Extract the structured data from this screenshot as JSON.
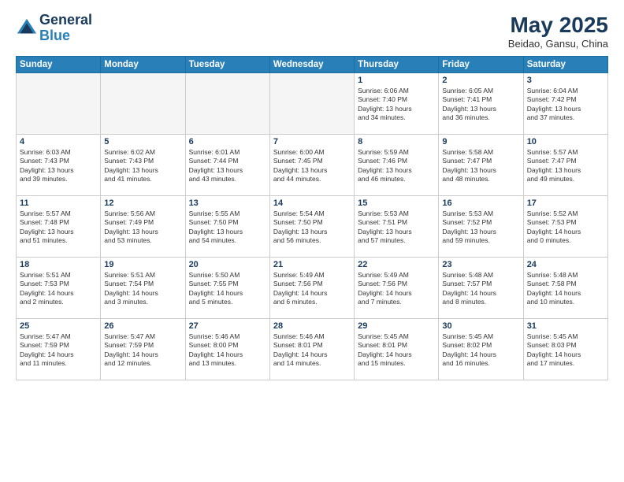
{
  "header": {
    "logo_line1": "General",
    "logo_line2": "Blue",
    "month_year": "May 2025",
    "location": "Beidao, Gansu, China"
  },
  "days_of_week": [
    "Sunday",
    "Monday",
    "Tuesday",
    "Wednesday",
    "Thursday",
    "Friday",
    "Saturday"
  ],
  "weeks": [
    [
      {
        "day": "",
        "info": ""
      },
      {
        "day": "",
        "info": ""
      },
      {
        "day": "",
        "info": ""
      },
      {
        "day": "",
        "info": ""
      },
      {
        "day": "1",
        "info": "Sunrise: 6:06 AM\nSunset: 7:40 PM\nDaylight: 13 hours\nand 34 minutes."
      },
      {
        "day": "2",
        "info": "Sunrise: 6:05 AM\nSunset: 7:41 PM\nDaylight: 13 hours\nand 36 minutes."
      },
      {
        "day": "3",
        "info": "Sunrise: 6:04 AM\nSunset: 7:42 PM\nDaylight: 13 hours\nand 37 minutes."
      }
    ],
    [
      {
        "day": "4",
        "info": "Sunrise: 6:03 AM\nSunset: 7:43 PM\nDaylight: 13 hours\nand 39 minutes."
      },
      {
        "day": "5",
        "info": "Sunrise: 6:02 AM\nSunset: 7:43 PM\nDaylight: 13 hours\nand 41 minutes."
      },
      {
        "day": "6",
        "info": "Sunrise: 6:01 AM\nSunset: 7:44 PM\nDaylight: 13 hours\nand 43 minutes."
      },
      {
        "day": "7",
        "info": "Sunrise: 6:00 AM\nSunset: 7:45 PM\nDaylight: 13 hours\nand 44 minutes."
      },
      {
        "day": "8",
        "info": "Sunrise: 5:59 AM\nSunset: 7:46 PM\nDaylight: 13 hours\nand 46 minutes."
      },
      {
        "day": "9",
        "info": "Sunrise: 5:58 AM\nSunset: 7:47 PM\nDaylight: 13 hours\nand 48 minutes."
      },
      {
        "day": "10",
        "info": "Sunrise: 5:57 AM\nSunset: 7:47 PM\nDaylight: 13 hours\nand 49 minutes."
      }
    ],
    [
      {
        "day": "11",
        "info": "Sunrise: 5:57 AM\nSunset: 7:48 PM\nDaylight: 13 hours\nand 51 minutes."
      },
      {
        "day": "12",
        "info": "Sunrise: 5:56 AM\nSunset: 7:49 PM\nDaylight: 13 hours\nand 53 minutes."
      },
      {
        "day": "13",
        "info": "Sunrise: 5:55 AM\nSunset: 7:50 PM\nDaylight: 13 hours\nand 54 minutes."
      },
      {
        "day": "14",
        "info": "Sunrise: 5:54 AM\nSunset: 7:50 PM\nDaylight: 13 hours\nand 56 minutes."
      },
      {
        "day": "15",
        "info": "Sunrise: 5:53 AM\nSunset: 7:51 PM\nDaylight: 13 hours\nand 57 minutes."
      },
      {
        "day": "16",
        "info": "Sunrise: 5:53 AM\nSunset: 7:52 PM\nDaylight: 13 hours\nand 59 minutes."
      },
      {
        "day": "17",
        "info": "Sunrise: 5:52 AM\nSunset: 7:53 PM\nDaylight: 14 hours\nand 0 minutes."
      }
    ],
    [
      {
        "day": "18",
        "info": "Sunrise: 5:51 AM\nSunset: 7:53 PM\nDaylight: 14 hours\nand 2 minutes."
      },
      {
        "day": "19",
        "info": "Sunrise: 5:51 AM\nSunset: 7:54 PM\nDaylight: 14 hours\nand 3 minutes."
      },
      {
        "day": "20",
        "info": "Sunrise: 5:50 AM\nSunset: 7:55 PM\nDaylight: 14 hours\nand 5 minutes."
      },
      {
        "day": "21",
        "info": "Sunrise: 5:49 AM\nSunset: 7:56 PM\nDaylight: 14 hours\nand 6 minutes."
      },
      {
        "day": "22",
        "info": "Sunrise: 5:49 AM\nSunset: 7:56 PM\nDaylight: 14 hours\nand 7 minutes."
      },
      {
        "day": "23",
        "info": "Sunrise: 5:48 AM\nSunset: 7:57 PM\nDaylight: 14 hours\nand 8 minutes."
      },
      {
        "day": "24",
        "info": "Sunrise: 5:48 AM\nSunset: 7:58 PM\nDaylight: 14 hours\nand 10 minutes."
      }
    ],
    [
      {
        "day": "25",
        "info": "Sunrise: 5:47 AM\nSunset: 7:59 PM\nDaylight: 14 hours\nand 11 minutes."
      },
      {
        "day": "26",
        "info": "Sunrise: 5:47 AM\nSunset: 7:59 PM\nDaylight: 14 hours\nand 12 minutes."
      },
      {
        "day": "27",
        "info": "Sunrise: 5:46 AM\nSunset: 8:00 PM\nDaylight: 14 hours\nand 13 minutes."
      },
      {
        "day": "28",
        "info": "Sunrise: 5:46 AM\nSunset: 8:01 PM\nDaylight: 14 hours\nand 14 minutes."
      },
      {
        "day": "29",
        "info": "Sunrise: 5:45 AM\nSunset: 8:01 PM\nDaylight: 14 hours\nand 15 minutes."
      },
      {
        "day": "30",
        "info": "Sunrise: 5:45 AM\nSunset: 8:02 PM\nDaylight: 14 hours\nand 16 minutes."
      },
      {
        "day": "31",
        "info": "Sunrise: 5:45 AM\nSunset: 8:03 PM\nDaylight: 14 hours\nand 17 minutes."
      }
    ]
  ]
}
